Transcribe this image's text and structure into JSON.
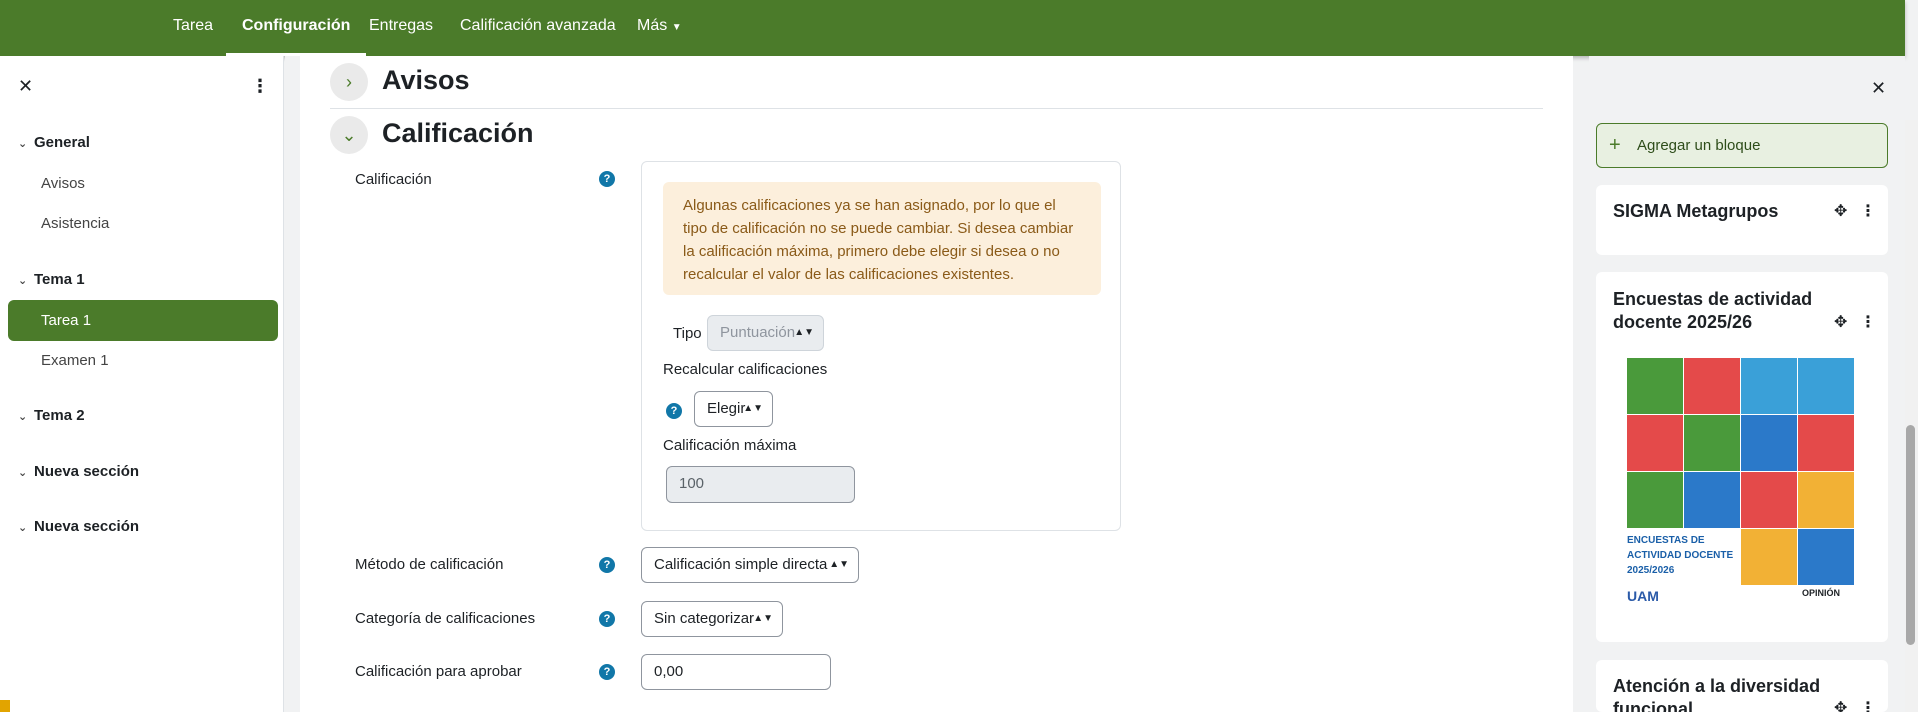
{
  "topnav": {
    "tabs": [
      {
        "label": "Tarea",
        "active": false
      },
      {
        "label": "Configuración",
        "active": true
      },
      {
        "label": "Entregas",
        "active": false
      },
      {
        "label": "Calificación avanzada",
        "active": false
      },
      {
        "label": "Más",
        "active": false
      }
    ]
  },
  "leftdrawer": {
    "sections": [
      {
        "label": "General",
        "items": [
          "Avisos",
          "Asistencia"
        ]
      },
      {
        "label": "Tema 1",
        "items": [
          "Tarea 1",
          "Examen 1"
        ]
      },
      {
        "label": "Tema 2",
        "items": []
      },
      {
        "label": "Nueva sección",
        "items": []
      },
      {
        "label": "Nueva sección",
        "items": []
      }
    ],
    "active_item": "Tarea 1"
  },
  "main": {
    "sections": {
      "avisos": "Avisos",
      "calificacion": "Calificación"
    },
    "grade": {
      "label": "Calificación",
      "alert": "Algunas calificaciones ya se han asignado, por lo que el tipo de calificación no se puede cambiar. Si desea cambiar la calificación máxima, primero debe elegir si desea o no recalcular el valor de las calificaciones existentes.",
      "tipo_label": "Tipo",
      "tipo_value": "Puntuación",
      "recalc_label": "Recalcular calificaciones",
      "recalc_value": "Elegir",
      "max_label": "Calificación máxima",
      "max_value": "100"
    },
    "metodo": {
      "label": "Método de calificación",
      "value": "Calificación simple directa"
    },
    "categoria": {
      "label": "Categoría de calificaciones",
      "value": "Sin categorizar"
    },
    "aprobar": {
      "label": "Calificación para aprobar",
      "value": "0,00"
    }
  },
  "rightdrawer": {
    "add_block": "Agregar un bloque",
    "blocks": [
      {
        "title": "SIGMA Metagrupos"
      },
      {
        "title": "Encuestas de actividad docente 2025/26"
      },
      {
        "title": "Atención a la diversidad funcional"
      }
    ],
    "poster": {
      "text": "ENCUESTAS DE ACTIVIDAD DOCENTE 2025/2026",
      "logo_left": "UAM",
      "logo_right": "OPINIÓN"
    }
  },
  "colors": {
    "brand": "#4b7b2a",
    "alert_bg": "#fcefdc",
    "alert_text": "#8a5a18",
    "help": "#1177a8"
  },
  "icons": {
    "close": "close-icon",
    "kebab": "kebab-icon",
    "chevron": "chevron-icon",
    "help": "help-icon",
    "move": "move-icon",
    "plus": "plus-icon"
  }
}
